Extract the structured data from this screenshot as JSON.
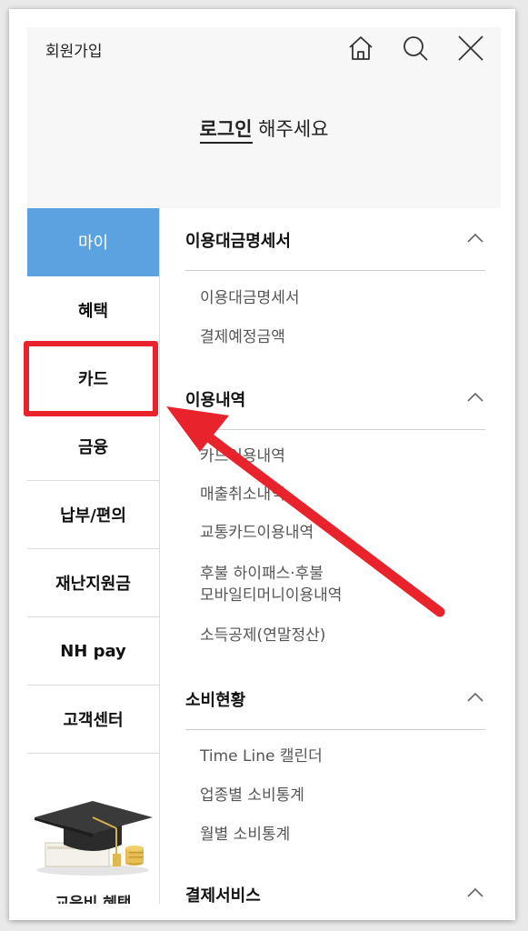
{
  "header": {
    "signup_label": "회원가입",
    "login_link": "로그인",
    "login_suffix": " 해주세요",
    "icons": [
      "home-icon",
      "search-icon",
      "close-icon"
    ]
  },
  "sidebar": {
    "items": [
      {
        "label": "마이",
        "active": true
      },
      {
        "label": "혜택"
      },
      {
        "label": "카드"
      },
      {
        "label": "금융"
      },
      {
        "label": "납부/편의"
      },
      {
        "label": "재난지원금"
      },
      {
        "label": "NH pay"
      },
      {
        "label": "고객센터"
      }
    ],
    "promo_caption": "교육비 혜택"
  },
  "sections": [
    {
      "title": "이용대금명세서",
      "items": [
        "이용대금명세서",
        "결제예정금액"
      ]
    },
    {
      "title": "이용내역",
      "items": [
        "카드이용내역",
        "매출취소내역",
        "교통카드이용내역",
        "후불 하이패스·후불\n모바일티머니이용내역",
        "소득공제(연말정산)"
      ]
    },
    {
      "title": "소비현황",
      "items": [
        "Time Line 캘린더",
        "업종별 소비통계",
        "월별 소비통계"
      ]
    },
    {
      "title": "결제서비스",
      "items": []
    }
  ],
  "colors": {
    "active_tab": "#5ba2e0",
    "highlight": "#e8232c"
  }
}
